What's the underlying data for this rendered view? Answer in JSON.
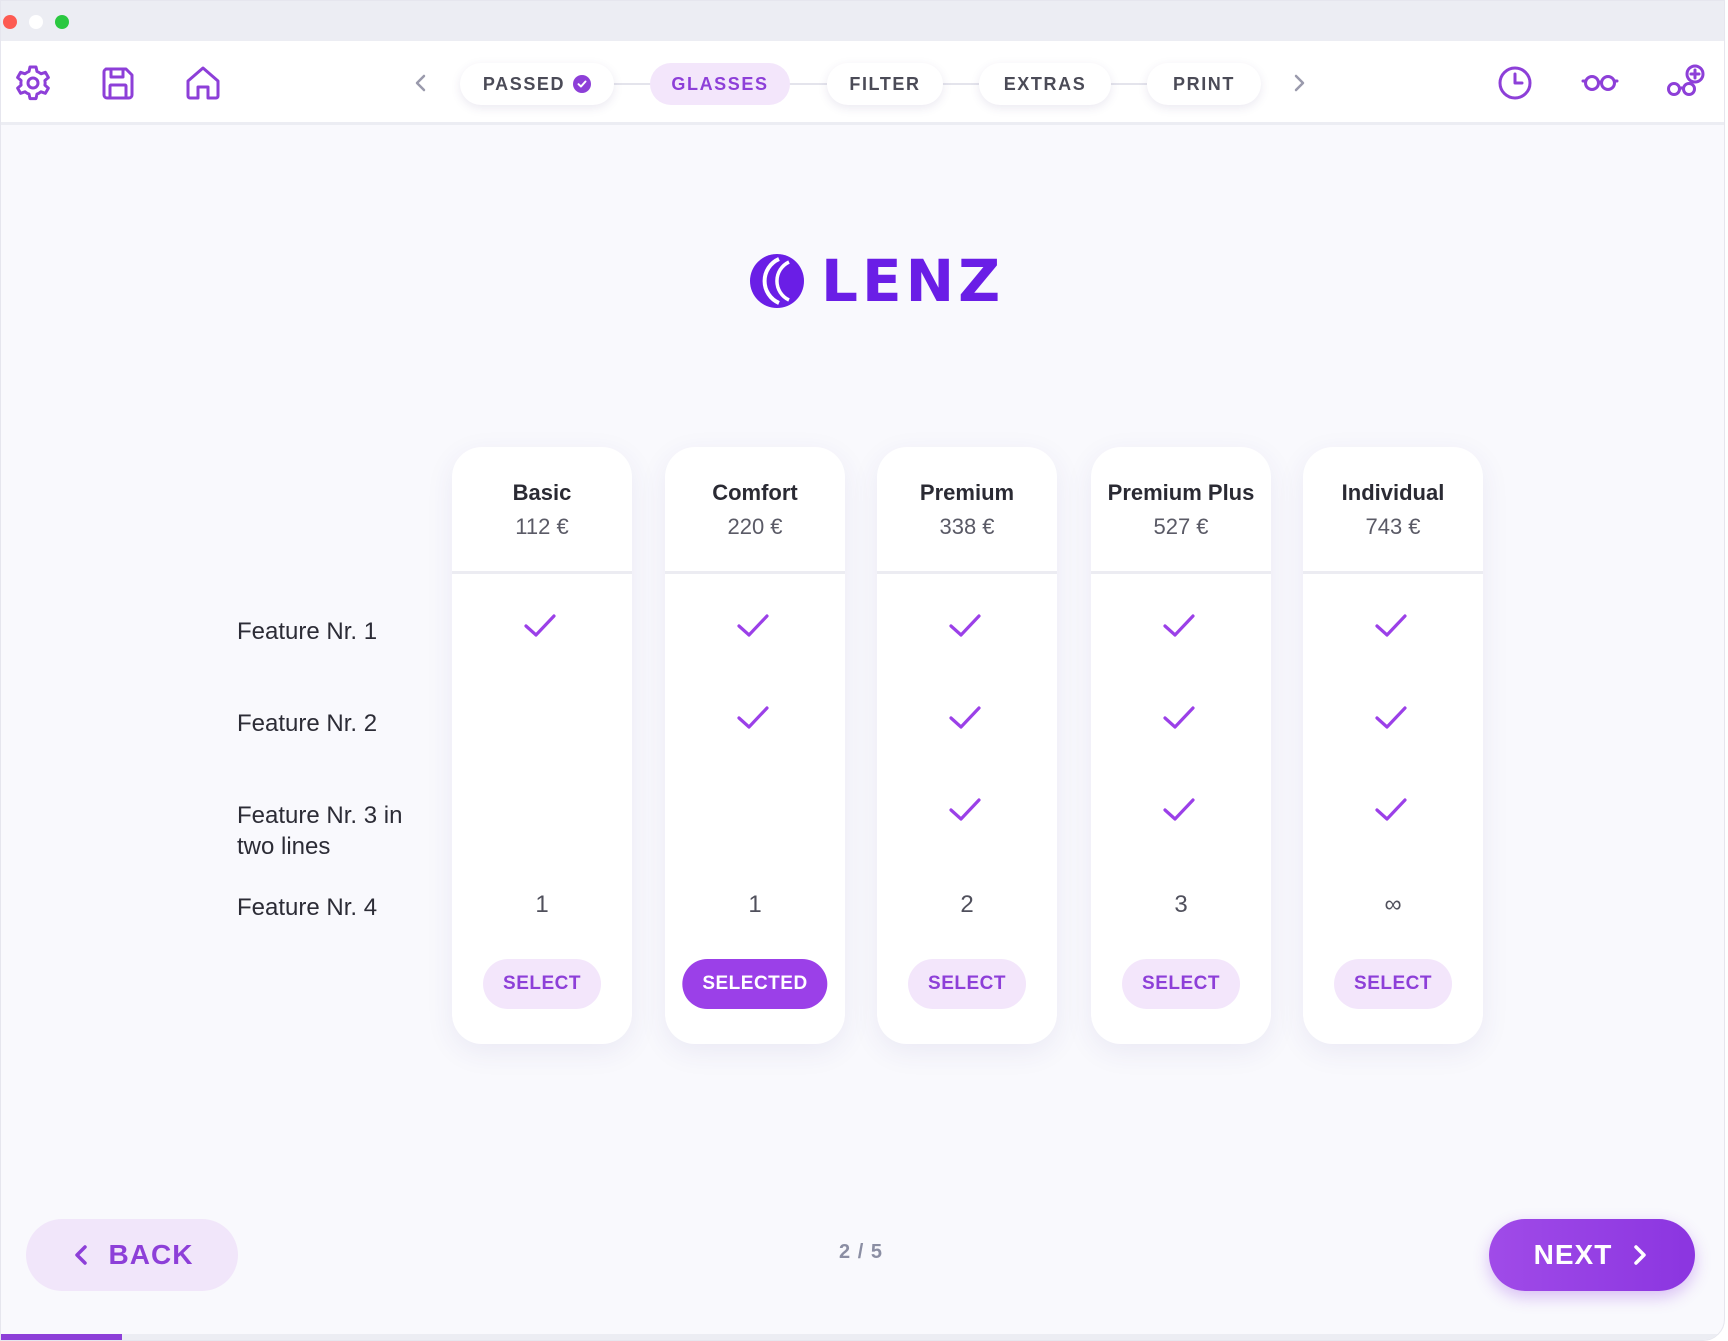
{
  "toolbar": {
    "left_icons": [
      "gear-icon",
      "save-icon",
      "home-icon"
    ],
    "right_icons": [
      "history-clock-icon",
      "glasses-icon",
      "add-glasses-icon"
    ],
    "steps": [
      {
        "label": "PASSED",
        "state": "done"
      },
      {
        "label": "GLASSES",
        "state": "active"
      },
      {
        "label": "FILTER",
        "state": "pending"
      },
      {
        "label": "EXTRAS",
        "state": "pending"
      },
      {
        "label": "PRINT",
        "state": "pending"
      }
    ]
  },
  "logo": {
    "text": "LENZ",
    "color": "#6a1ee6"
  },
  "features": [
    "Feature Nr. 1",
    "Feature Nr. 2",
    "Feature Nr. 3 in two lines",
    "Feature Nr. 4"
  ],
  "plans": [
    {
      "name": "Basic",
      "price": "112 €",
      "features": [
        true,
        false,
        false
      ],
      "count": "1",
      "button": "SELECT",
      "selected": false
    },
    {
      "name": "Comfort",
      "price": "220 €",
      "features": [
        true,
        true,
        false
      ],
      "count": "1",
      "button": "SELECTED",
      "selected": true
    },
    {
      "name": "Premium",
      "price": "338 €",
      "features": [
        true,
        true,
        true
      ],
      "count": "2",
      "button": "SELECT",
      "selected": false
    },
    {
      "name": "Premium Plus",
      "price": "527 €",
      "features": [
        true,
        true,
        true
      ],
      "count": "3",
      "button": "SELECT",
      "selected": false
    },
    {
      "name": "Individual",
      "price": "743 €",
      "features": [
        true,
        true,
        true
      ],
      "count": "∞",
      "button": "SELECT",
      "selected": false
    }
  ],
  "nav": {
    "back_label": "BACK",
    "next_label": "NEXT",
    "page_indicator": "2 / 5",
    "progress": 0.07
  },
  "colors": {
    "accent": "#8d3fd8",
    "accent_light": "#f3e6fb",
    "brand": "#6a1ee6"
  }
}
